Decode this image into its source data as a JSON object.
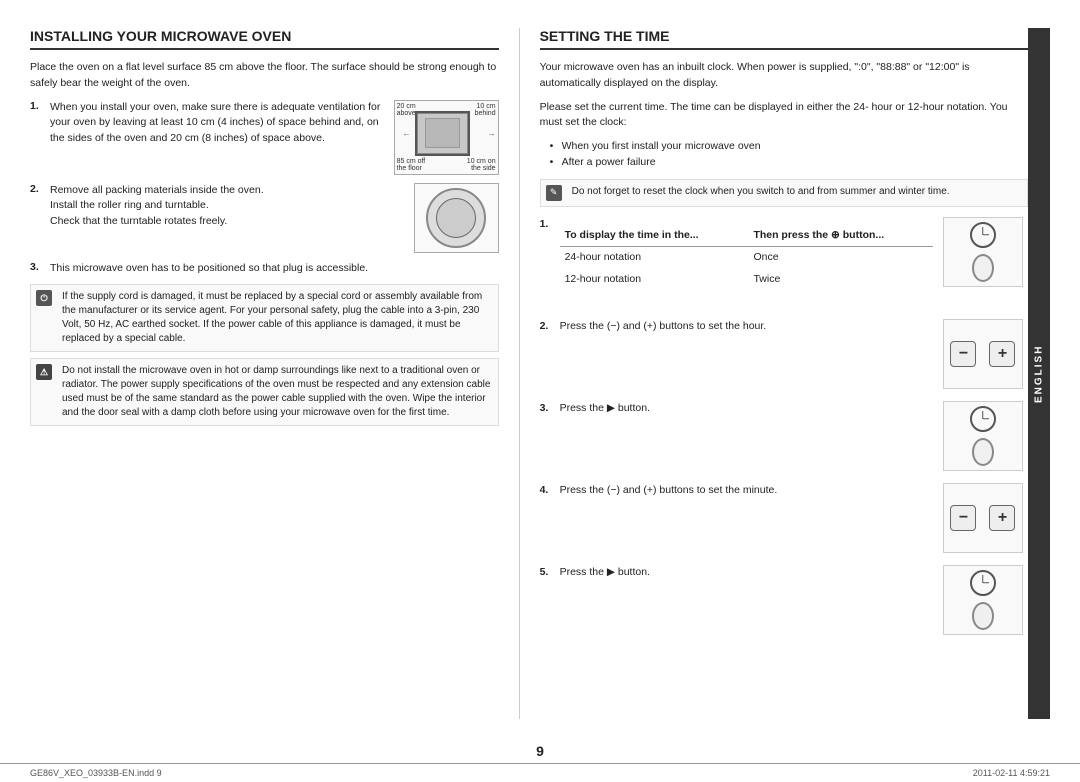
{
  "page": {
    "number": "9",
    "footer_left": "GE86V_XEO_03933B-EN.indd  9",
    "footer_right": "2011-02-11   4:59:21"
  },
  "sidebar": {
    "language": "ENGLISH"
  },
  "installing": {
    "title": "INSTALLING YOUR MICROWAVE OVEN",
    "intro": "Place the oven on a flat level surface 85 cm above the floor. The surface should be strong enough to safely bear the weight of the oven.",
    "step1": {
      "num": "1.",
      "text": "When you install your oven, make sure there is adequate ventilation for your oven by leaving at least 10 cm (4 inches) of space behind and, on the sides of the oven and 20 cm (8 inches) of space above.",
      "diagram_labels": {
        "top_left": "20 cm above",
        "top_right": "10 cm behind",
        "bottom_left": "85 cm off the floor",
        "bottom_right": "10 cm on the side"
      }
    },
    "step2": {
      "num": "2.",
      "text1": "Remove all packing materials inside the oven.",
      "text2": "Install the roller ring and turntable.",
      "text3": "Check that the turntable rotates freely."
    },
    "step3": {
      "num": "3.",
      "text": "This microwave oven has to be positioned so that plug is accessible."
    },
    "note1": {
      "text": "If the supply cord is damaged, it must be replaced by a special cord or assembly available from the manufacturer or its service agent. For your personal safety, plug the cable into a 3-pin, 230 Volt, 50 Hz, AC earthed socket. If the power cable of this appliance is damaged, it must be replaced by a special cable."
    },
    "note2": {
      "text": "Do not install the microwave oven in hot or damp surroundings like next to a traditional oven or radiator. The power supply specifications of the oven must be respected and any extension cable used must be of the same standard as the power cable supplied with the oven. Wipe the interior and the door seal with a damp cloth before using your microwave oven for the first time."
    }
  },
  "setting": {
    "title": "SETTING THE TIME",
    "intro": "Your microwave oven has an inbuilt clock. When power is supplied, \":0\", \"88:88\" or \"12:00\" is automatically displayed on the display.",
    "details": "Please set the current time. The time can be displayed in either the 24- hour or 12-hour notation. You must set the clock:",
    "bullets": [
      "When you first install your microwave oven",
      "After a power failure"
    ],
    "note": "Do not forget to reset the clock when you switch to and from summer and winter time.",
    "steps": [
      {
        "num": "1.",
        "col1_header": "To display the time in the...",
        "col2_header": "Then press the ▶ button...",
        "rows": [
          {
            "col1": "24-hour notation",
            "col2": "Once"
          },
          {
            "col1": "12-hour notation",
            "col2": "Twice"
          }
        ]
      },
      {
        "num": "2.",
        "text": "Press the (−) and (+) buttons to set the hour."
      },
      {
        "num": "3.",
        "text": "Press the ▶ button."
      },
      {
        "num": "4.",
        "text": "Press the (−) and (+) buttons to set the minute."
      },
      {
        "num": "5.",
        "text": "Press the ▶ button."
      }
    ]
  }
}
